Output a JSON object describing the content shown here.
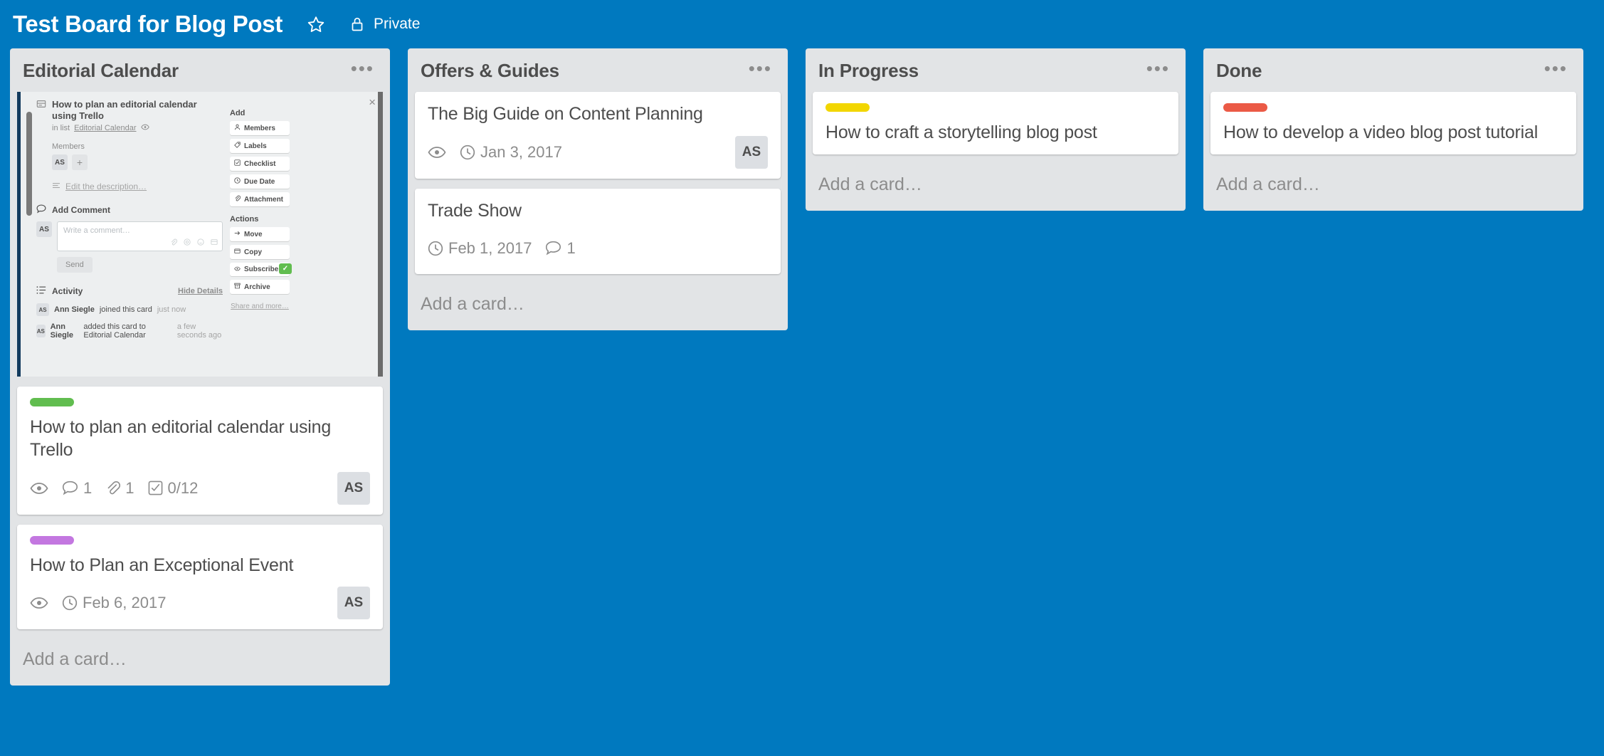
{
  "header": {
    "title": "Test Board for Blog Post",
    "star_icon": "star-icon",
    "lock_icon": "lock-icon",
    "visibility": "Private"
  },
  "board": {
    "background_color": "#0079bf",
    "list_background": "#e2e4e6",
    "add_card_label": "Add a card…",
    "list_menu_glyph": "•••",
    "lists": [
      {
        "name": "Editorial Calendar",
        "cards": [
          {
            "title": "How to plan an editorial calendar using Trello",
            "label_color": "#61bd4f",
            "badges": [
              {
                "type": "watch",
                "icon": "eye-icon",
                "text": ""
              },
              {
                "type": "comments",
                "icon": "comment-icon",
                "text": "1"
              },
              {
                "type": "attachments",
                "icon": "attachment-icon",
                "text": "1"
              },
              {
                "type": "checklist",
                "icon": "checklist-icon",
                "text": "0/12"
              }
            ],
            "member": "AS"
          },
          {
            "title": "How to Plan an Exceptional Event",
            "label_color": "#c377e0",
            "badges": [
              {
                "type": "watch",
                "icon": "eye-icon",
                "text": ""
              },
              {
                "type": "due",
                "icon": "clock-icon",
                "text": "Feb 6, 2017"
              }
            ],
            "member": "AS"
          }
        ]
      },
      {
        "name": "Offers & Guides",
        "cards": [
          {
            "title": "The Big Guide on Content Planning",
            "label_color": null,
            "badges": [
              {
                "type": "watch",
                "icon": "eye-icon",
                "text": ""
              },
              {
                "type": "due",
                "icon": "clock-icon",
                "text": "Jan 3, 2017"
              }
            ],
            "member": "AS"
          },
          {
            "title": "Trade Show",
            "label_color": null,
            "badges": [
              {
                "type": "due",
                "icon": "clock-icon",
                "text": "Feb 1, 2017"
              },
              {
                "type": "comments",
                "icon": "comment-icon",
                "text": "1"
              }
            ],
            "member": null
          }
        ]
      },
      {
        "name": "In Progress",
        "cards": [
          {
            "title": "How to craft a storytelling blog post",
            "label_color": "#f2d600",
            "badges": [],
            "member": null
          }
        ]
      },
      {
        "name": "Done",
        "cards": [
          {
            "title": "How to develop a video blog post tutorial",
            "label_color": "#eb5a46",
            "badges": [],
            "member": null
          }
        ]
      }
    ]
  },
  "card_detail": {
    "close_glyph": "×",
    "title": "How to plan an editorial calendar using Trello",
    "in_list_prefix": "in list",
    "in_list_name": "Editorial Calendar",
    "watch_icon": "eye-icon",
    "members_label": "Members",
    "member_initials": "AS",
    "add_member_glyph": "+",
    "description_placeholder": "Edit the description…",
    "comment_section_title": "Add Comment",
    "comment_avatar": "AS",
    "comment_placeholder": "Write a comment…",
    "send_label": "Send",
    "activity_title": "Activity",
    "hide_details_label": "Hide Details",
    "activity": [
      {
        "avatar": "AS",
        "user": "Ann Siegle",
        "action": "joined this card",
        "when": "just now"
      },
      {
        "avatar": "AS",
        "user": "Ann Siegle",
        "action": "added this card to Editorial Calendar",
        "when": "a few seconds ago"
      }
    ],
    "sidebar": {
      "add_label": "Add",
      "add_items": [
        {
          "label": "Members",
          "icon": "person-icon"
        },
        {
          "label": "Labels",
          "icon": "label-icon"
        },
        {
          "label": "Checklist",
          "icon": "checklist-icon"
        },
        {
          "label": "Due Date",
          "icon": "clock-icon"
        },
        {
          "label": "Attachment",
          "icon": "attachment-icon"
        }
      ],
      "actions_label": "Actions",
      "action_items": [
        {
          "label": "Move",
          "icon": "arrow-right-icon",
          "checked": false
        },
        {
          "label": "Copy",
          "icon": "copy-icon",
          "checked": false
        },
        {
          "label": "Subscribe",
          "icon": "eye-icon",
          "checked": true
        },
        {
          "label": "Archive",
          "icon": "archive-icon",
          "checked": false
        }
      ],
      "check_glyph": "✓",
      "check_color": "#61bd4f",
      "share_label": "Share and more…"
    },
    "comment_tool_icons": [
      "attachment-icon",
      "mention-icon",
      "emoji-icon",
      "card-icon"
    ]
  }
}
